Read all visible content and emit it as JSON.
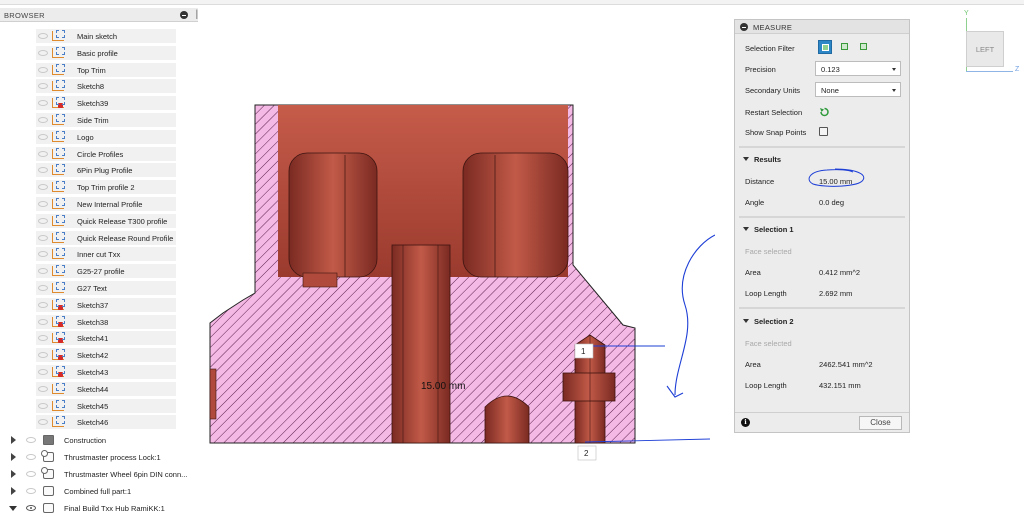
{
  "browser": {
    "title": "BROWSER",
    "sketches": [
      {
        "label": "Main sketch",
        "error": false
      },
      {
        "label": "Basic profile",
        "error": false
      },
      {
        "label": "Top Trim",
        "error": false
      },
      {
        "label": "Sketch8",
        "error": false
      },
      {
        "label": "Sketch39",
        "error": true
      },
      {
        "label": "Side Trim",
        "error": false
      },
      {
        "label": "Logo",
        "error": false
      },
      {
        "label": "Circle Profiles",
        "error": false
      },
      {
        "label": "6Pin Plug Profile",
        "error": false
      },
      {
        "label": "Top Trim profile 2",
        "error": false
      },
      {
        "label": "New Internal Profile",
        "error": false
      },
      {
        "label": "Quick Release T300 profile",
        "error": false
      },
      {
        "label": "Quick Release Round Profile",
        "error": false
      },
      {
        "label": "Inner cut Txx",
        "error": false
      },
      {
        "label": "G25-27 profile",
        "error": false
      },
      {
        "label": "G27 Text",
        "error": false
      },
      {
        "label": "Sketch37",
        "error": true
      },
      {
        "label": "Sketch38",
        "error": true
      },
      {
        "label": "Sketch41",
        "error": true
      },
      {
        "label": "Sketch42",
        "error": true
      },
      {
        "label": "Sketch43",
        "error": true
      },
      {
        "label": "Sketch44",
        "error": false
      },
      {
        "label": "Sketch45",
        "error": false
      },
      {
        "label": "Sketch46",
        "error": false
      }
    ],
    "components": [
      {
        "label": "Construction",
        "icon": "folder-icon",
        "expanded": false
      },
      {
        "label": "Thrustmaster process Lock:1",
        "icon": "component-link-icon",
        "expanded": false
      },
      {
        "label": "Thrustmaster Wheel 6pin DIN conn...",
        "icon": "component-link-icon",
        "expanded": false
      },
      {
        "label": "Combined full part:1",
        "icon": "component-icon",
        "expanded": false
      },
      {
        "label": "Final Build Txx Hub RamiKK:1",
        "icon": "component-icon",
        "expanded": true
      }
    ]
  },
  "canvas": {
    "dimension_label": "15.00 mm",
    "marker_1": "1",
    "marker_2": "2",
    "body_color": "#b54a3c",
    "hatch_color": "#f4b9e4"
  },
  "measure": {
    "title": "MEASURE",
    "selection_filter_label": "Selection Filter",
    "precision_label": "Precision",
    "precision_value": "0.123",
    "secondary_units_label": "Secondary Units",
    "secondary_units_value": "None",
    "restart_label": "Restart Selection",
    "snap_label": "Show Snap Points",
    "results": {
      "title": "Results",
      "distance_label": "Distance",
      "distance_value": "15.00 mm",
      "angle_label": "Angle",
      "angle_value": "0.0 deg"
    },
    "selection1": {
      "title": "Selection 1",
      "status": "Face selected",
      "area_label": "Area",
      "area_value": "0.412 mm^2",
      "loop_label": "Loop Length",
      "loop_value": "2.692 mm"
    },
    "selection2": {
      "title": "Selection 2",
      "status": "Face selected",
      "area_label": "Area",
      "area_value": "2462.541 mm^2",
      "loop_label": "Loop Length",
      "loop_value": "432.151 mm"
    },
    "close_label": "Close"
  },
  "viewcube": {
    "face_label": "LEFT",
    "axis_y": "Y",
    "axis_z": "Z"
  },
  "colors": {
    "annotation_ink": "#1e3fd6",
    "accent_blue": "#2d86c6"
  }
}
